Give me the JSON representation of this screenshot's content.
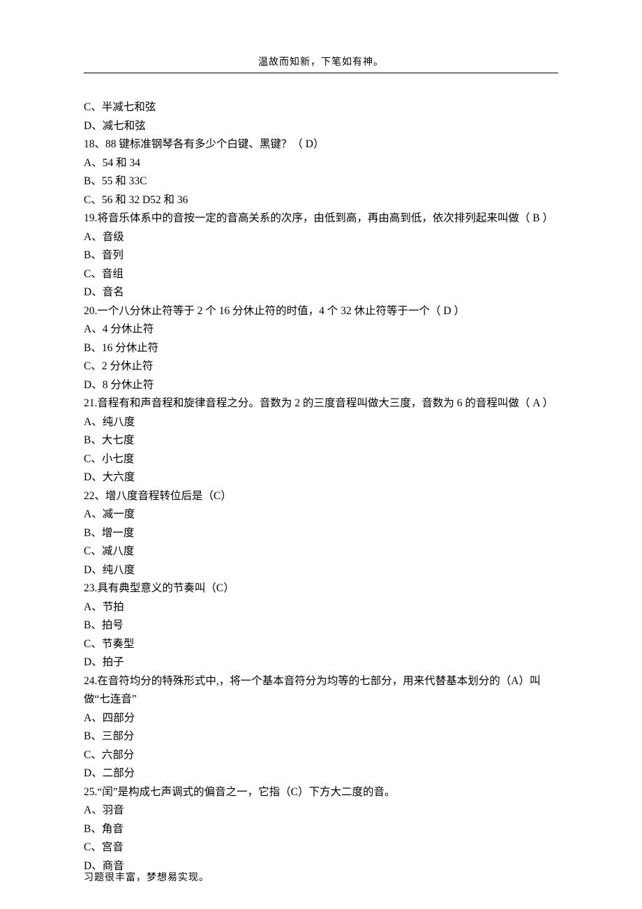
{
  "header": "温故而知新，下笔如有神。",
  "footer": "习题很丰富，梦想易实现。",
  "lines": [
    "C、半减七和弦",
    "D、减七和弦",
    "18、88 键标准钢琴各有多少个白键、黑键？（ D）",
    "A、54 和 34",
    "B、55 和 33C",
    "C、56 和 32 D52 和 36",
    "19.将音乐体系中的音按一定的音高关系的次序，由低到高，再由高到低，依次排列起来叫做（ B ）",
    "A、音级",
    "B、音列",
    "C、音组",
    "D、音名",
    "20.一个八分休止符等于 2 个 16 分休止符的时值，4 个 32 休止符等于一个（ D ）",
    "A、4 分休止符",
    "B、16 分休止符",
    "C、2 分休止符",
    "D、8 分休止符",
    "21.音程有和声音程和旋律音程之分。音数为 2 的三度音程叫做大三度，音数为 6 的音程叫做（ A ）",
    "A、纯八度",
    "B、大七度",
    "C、小七度",
    "D、大六度",
    "22、增八度音程转位后是（C）",
    "A、减一度",
    "B、增一度",
    "C、减八度",
    "D、纯八度",
    "23.具有典型意义的节奏叫（C）",
    "A、节拍",
    "B、拍号",
    "C、节奏型",
    "D、拍子",
    "24.在音符均分的特殊形式中,，将一个基本音符分为均等的七部分，用来代替基本划分的（A）叫做“七连音”",
    "A、四部分",
    "B、三部分",
    "C、六部分",
    "D、二部分",
    "25.“闰”是构成七声调式的偏音之一，它指（C）下方大二度的音。",
    "A、羽音",
    "B、角音",
    "C、宫音",
    "D、商音"
  ]
}
